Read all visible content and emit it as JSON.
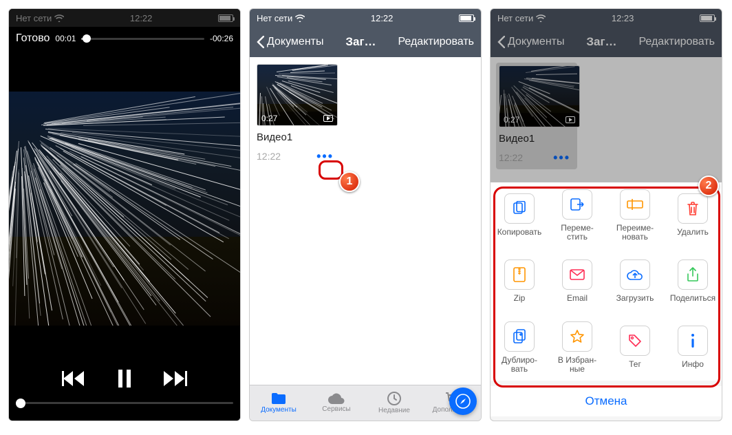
{
  "status": {
    "carrier": "Нет сети",
    "time_a": "12:22",
    "time_b": "12:22",
    "time_c": "12:23"
  },
  "player": {
    "done": "Готово",
    "elapsed": "00:01",
    "remaining": "-00:26"
  },
  "docs": {
    "back": "Документы",
    "title": "Заг…",
    "edit": "Редактировать",
    "video": {
      "duration": "0:27",
      "name": "Видео1",
      "time": "12:22"
    },
    "tabs": {
      "documents": "Документы",
      "services": "Сервисы",
      "recent": "Недавние",
      "addons": "Дополнения"
    }
  },
  "sheet": {
    "copy": "Копировать",
    "move": "Переме-\nстить",
    "rename": "Переиме-\nновать",
    "delete": "Удалить",
    "zip": "Zip",
    "email": "Email",
    "upload": "Загрузить",
    "share": "Поделиться",
    "duplicate": "Дублиро-\nвать",
    "favorite": "В Избран-\nные",
    "tag": "Тег",
    "info": "Инфо",
    "cancel": "Отмена"
  },
  "callouts": {
    "one": "1",
    "two": "2"
  },
  "colors": {
    "accent": "#0a6cff",
    "nav": "#4e5764",
    "danger": "#ff3b30",
    "orange": "#ff9500",
    "green": "#34c759",
    "pink": "#ff2d55"
  }
}
